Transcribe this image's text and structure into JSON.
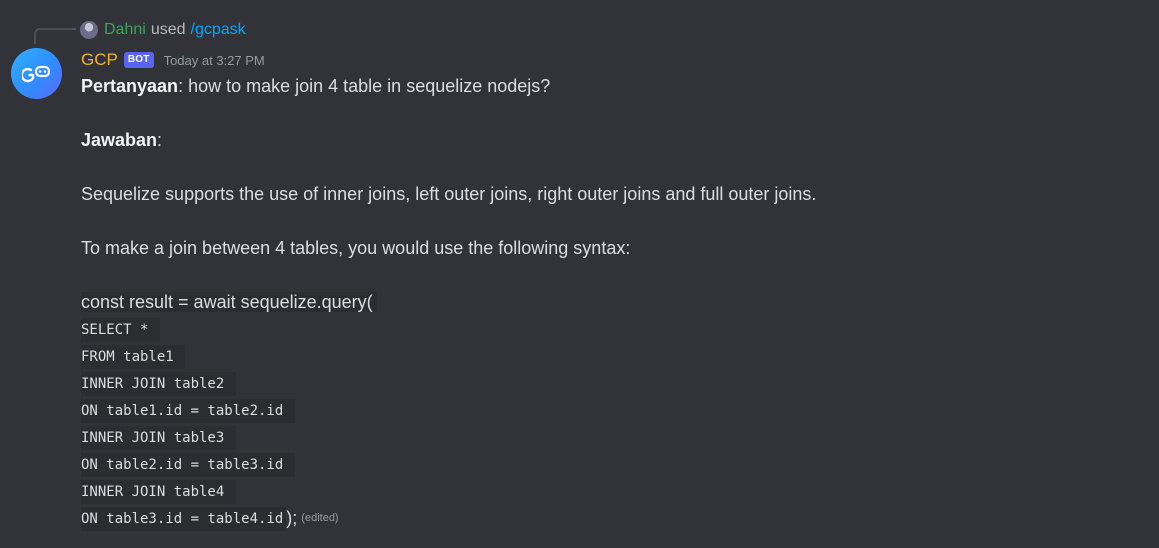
{
  "interaction": {
    "user": "Dahni",
    "used_text": "used",
    "command": "/gcpask"
  },
  "message": {
    "author": "GCP",
    "bot_tag": "BOT",
    "timestamp": "Today at 3:27 PM",
    "question_label": "Pertanyaan",
    "question_text": ": how to make join 4 table in sequelize nodejs?",
    "answer_label": "Jawaban",
    "answer_colon": ":",
    "paragraph1": "Sequelize supports the use of inner joins, left outer joins, right outer joins and full outer joins.",
    "paragraph2": "To make a join between 4 tables, you would use the following syntax:",
    "code_intro": "const result = await sequelize.query(",
    "code_lines": [
      "SELECT * ",
      "FROM table1 ",
      "INNER JOIN table2 ",
      "ON table1.id = table2.id ",
      "INNER JOIN table3 ",
      "ON table2.id = table3.id ",
      "INNER JOIN table4 ",
      "ON table3.id = table4.id"
    ],
    "code_end": ");",
    "edited": "(edited)"
  },
  "colors": {
    "background": "#313338",
    "author": "#f0b232",
    "bot_tag": "#5865f2",
    "user": "#3ba55d",
    "command": "#00a8fc"
  }
}
